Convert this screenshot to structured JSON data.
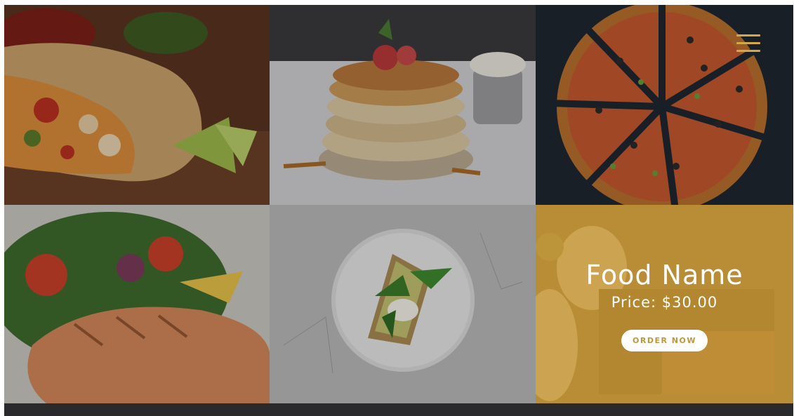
{
  "menu": {
    "icon": "hamburger-menu-icon"
  },
  "gallery": [
    {
      "dish": "burrito-image"
    },
    {
      "dish": "pancakes-image"
    },
    {
      "dish": "pizza-image"
    },
    {
      "dish": "salmon-salad-image"
    },
    {
      "dish": "avocado-toast-image"
    },
    {
      "dish": "sandwich-platter-image"
    }
  ],
  "featured": {
    "name": "Food Name",
    "price": "Price: $30.00",
    "order_button": "ORDER NOW",
    "overlay_color": "#c49634"
  },
  "colors": {
    "accent": "#d4a84a",
    "background": "#2a2a2c"
  }
}
